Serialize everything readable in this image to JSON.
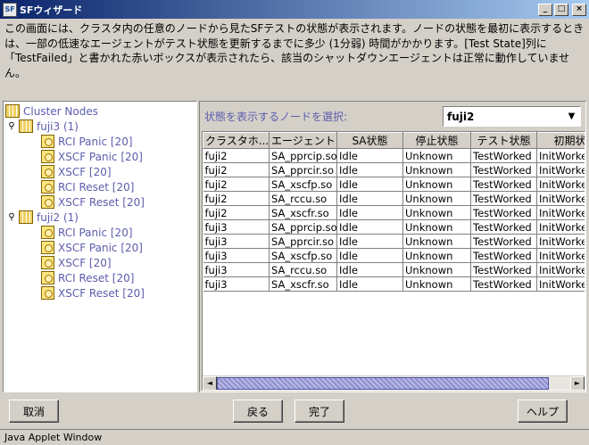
{
  "window": {
    "title": "SFウィザード",
    "app_icon_label": "SF",
    "minimize_glyph": "_",
    "maximize_glyph": "□",
    "close_glyph": "×"
  },
  "description": "この画面には、クラスタ内の任意のノードから見たSFテストの状態が表示されます。ノードの状態を最初に表示するときは、一部の低速なエージェントがテスト状態を更新するまでに多少 (1分弱) 時間がかかります。[Test State]列に「TestFailed」と書かれた赤いボックスが表示されたら、該当のシャットダウンエージェントは正常に動作していません。",
  "tree": {
    "root": "Cluster Nodes",
    "pin_glyph": "⚲",
    "nodes": [
      {
        "label": "fuji3 (1)",
        "children": [
          "RCI Panic [20]",
          "XSCF Panic [20]",
          "XSCF [20]",
          "RCI Reset [20]",
          "XSCF Reset [20]"
        ]
      },
      {
        "label": "fuji2 (1)",
        "children": [
          "RCI Panic [20]",
          "XSCF Panic [20]",
          "XSCF [20]",
          "RCI Reset [20]",
          "XSCF Reset [20]"
        ]
      }
    ]
  },
  "node_selector": {
    "label": "状態を表示するノードを選択:",
    "value": "fuji2",
    "arrow_glyph": "▼"
  },
  "table": {
    "columns": [
      "クラスタホ...",
      "エージェント",
      "SA状態",
      "停止状態",
      "テスト状態",
      "初期状態"
    ],
    "rows": [
      [
        "fuji2",
        "SA_pprcip.so",
        "Idle",
        "Unknown",
        "TestWorked",
        "InitWorked"
      ],
      [
        "fuji2",
        "SA_pprcir.so",
        "Idle",
        "Unknown",
        "TestWorked",
        "InitWorked"
      ],
      [
        "fuji2",
        "SA_xscfp.so",
        "Idle",
        "Unknown",
        "TestWorked",
        "InitWorked"
      ],
      [
        "fuji2",
        "SA_rccu.so",
        "Idle",
        "Unknown",
        "TestWorked",
        "InitWorked"
      ],
      [
        "fuji2",
        "SA_xscfr.so",
        "Idle",
        "Unknown",
        "TestWorked",
        "InitWorked"
      ],
      [
        "fuji3",
        "SA_pprcip.so",
        "Idle",
        "Unknown",
        "TestWorked",
        "InitWorked"
      ],
      [
        "fuji3",
        "SA_pprcir.so",
        "Idle",
        "Unknown",
        "TestWorked",
        "InitWorked"
      ],
      [
        "fuji3",
        "SA_xscfp.so",
        "Idle",
        "Unknown",
        "TestWorked",
        "InitWorked"
      ],
      [
        "fuji3",
        "SA_rccu.so",
        "Idle",
        "Unknown",
        "TestWorked",
        "InitWorked"
      ],
      [
        "fuji3",
        "SA_xscfr.so",
        "Idle",
        "Unknown",
        "TestWorked",
        "InitWorked"
      ]
    ],
    "scroll": {
      "left_glyph": "◄",
      "right_glyph": "►",
      "position_fraction": 0.0,
      "visible_fraction": 0.94
    }
  },
  "buttons": {
    "cancel": "取消",
    "back": "戻る",
    "finish": "完了",
    "help": "ヘルプ"
  },
  "status": "Java Applet Window"
}
